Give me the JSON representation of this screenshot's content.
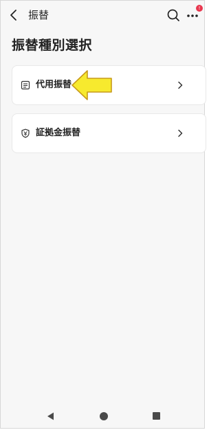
{
  "header": {
    "title": "振替",
    "back_icon": "back-chevron-icon",
    "search_icon": "search-icon",
    "more_icon": "more-dots-icon",
    "notification_badge": "!"
  },
  "page": {
    "title": "振替種別選択"
  },
  "options": [
    {
      "label": "代用振替",
      "icon": "document-icon"
    },
    {
      "label": "証拠金振替",
      "icon": "shield-yen-icon"
    }
  ],
  "annotation": {
    "arrow_color": "#f7ea2e",
    "arrow_outline": "#c79a1a"
  },
  "nav": {
    "back_icon": "triangle-back-icon",
    "home_icon": "circle-home-icon",
    "recent_icon": "square-recent-icon"
  },
  "colors": {
    "background": "#f7f7f7",
    "card": "#ffffff",
    "badge": "#e8384f"
  }
}
